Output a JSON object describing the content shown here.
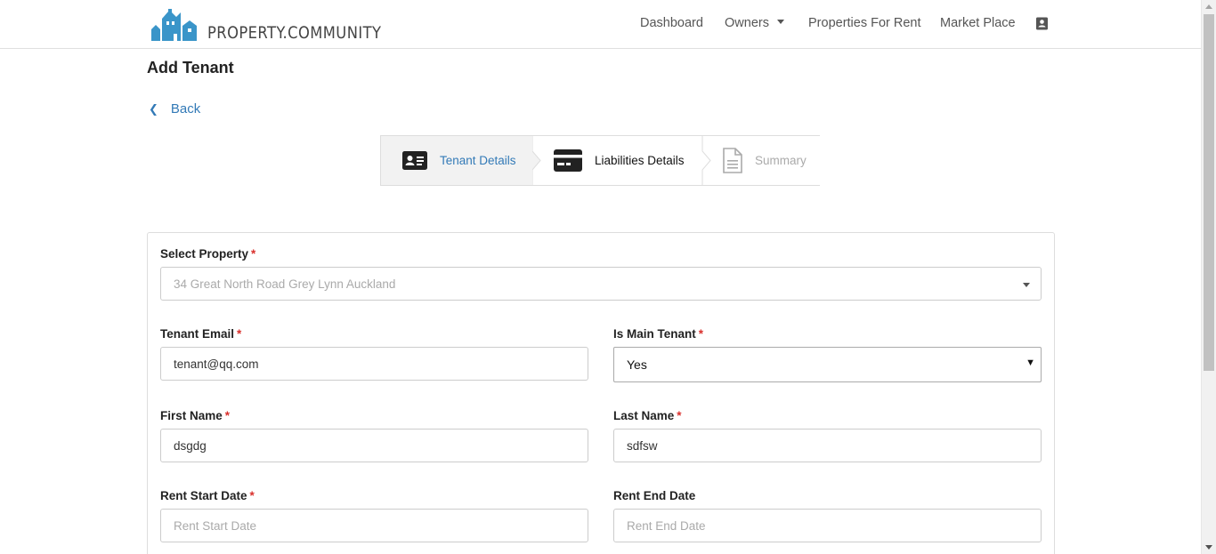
{
  "brand": {
    "name": "PROPERTY.COMMUNITY",
    "color": "#3a95c9"
  },
  "nav": {
    "items": [
      {
        "label": "Dashboard"
      },
      {
        "label": "Owners"
      },
      {
        "label": "Properties For Rent"
      },
      {
        "label": "Market Place"
      }
    ],
    "profile_icon": "contact-card-icon"
  },
  "page": {
    "title": "Add Tenant",
    "back_label": "Back"
  },
  "stepper": {
    "steps": [
      {
        "label": "Tenant Details",
        "icon": "id-card-icon",
        "state": "active"
      },
      {
        "label": "Liabilities Details",
        "icon": "credit-card-icon",
        "state": "completed"
      },
      {
        "label": "Summary",
        "icon": "document-icon",
        "state": "disabled"
      }
    ]
  },
  "form": {
    "property": {
      "label": "Select Property",
      "value": "34 Great North Road Grey Lynn Auckland"
    },
    "tenant_email": {
      "label": "Tenant Email",
      "value": "tenant@qq.com"
    },
    "is_main_tenant": {
      "label": "Is Main Tenant",
      "value": "Yes"
    },
    "first_name": {
      "label": "First Name",
      "value": "dsgdg"
    },
    "last_name": {
      "label": "Last Name",
      "value": "sdfsw"
    },
    "rent_start": {
      "label": "Rent Start Date",
      "placeholder": "Rent Start Date"
    },
    "rent_end": {
      "label": "Rent End Date",
      "placeholder": "Rent End Date"
    },
    "required_mark": "*"
  },
  "colors": {
    "link": "#337ab7",
    "required": "#d9302c",
    "active_step_bg": "#f2f2f2"
  }
}
